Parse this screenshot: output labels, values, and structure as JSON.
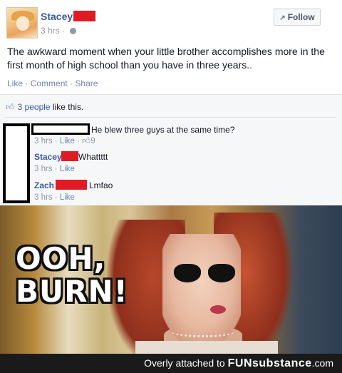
{
  "post": {
    "author": "Stacey",
    "time": "3 hrs",
    "follow_label": "Follow",
    "text": "The awkward moment when your little brother accomplishes more in the first month of high school than you have in three years..",
    "actions": [
      "Like",
      "Comment",
      "Share"
    ]
  },
  "likes": {
    "count_text": "3 people",
    "suffix": " like this."
  },
  "comments": [
    {
      "author": "",
      "text": "He blew three guys at the same time?",
      "time": "3 hrs",
      "like": "Like",
      "likes": "9"
    },
    {
      "author": "Stacey",
      "text": "Whattttt",
      "time": "3 hrs",
      "like": "Like"
    },
    {
      "author": "Zach",
      "text": "Lmfao",
      "time": "3 hrs",
      "like": "Like"
    }
  ],
  "meme": {
    "line1": "OOH,",
    "line2": "BURN!"
  },
  "footer": {
    "prefix": "Overly attached to ",
    "brand": "FUNsubstance",
    "suffix": ".com"
  },
  "colors": {
    "redaction": "#e01b24",
    "link": "#3b5998",
    "muted": "#9197a3"
  },
  "icons": [
    "globe-icon",
    "rss-icon",
    "thumbs-up-icon"
  ]
}
